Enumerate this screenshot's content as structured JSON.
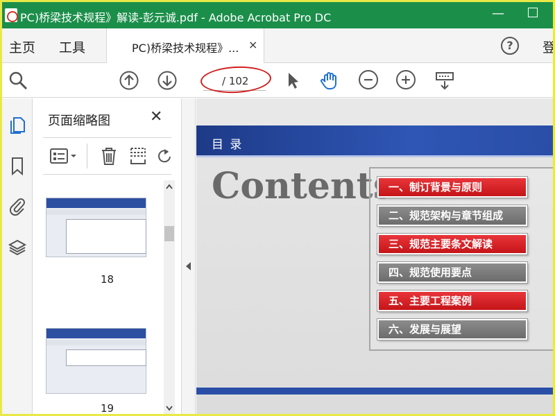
{
  "window": {
    "title": "PC)桥梁技术规程》解读-彭元诚.pdf - Adobe Acrobat Pro DC",
    "minimize_symbol": "—"
  },
  "tabs": {
    "home": "主页",
    "tools": "工具",
    "document": "PC)桥梁技术规程》...",
    "close_symbol": "×",
    "help_symbol": "?",
    "signin": "登"
  },
  "toolbar": {
    "page_total": "/ 102",
    "icons": [
      "search-icon",
      "page-up-icon",
      "page-down-icon",
      "select-arrow-icon",
      "hand-tool-icon",
      "zoom-out-icon",
      "zoom-in-icon",
      "keyboard-icon"
    ],
    "highlight_color": "#d11e1e"
  },
  "rail": {
    "icons": [
      "pages-icon",
      "bookmark-icon",
      "attachment-icon",
      "layers-icon"
    ]
  },
  "panel": {
    "title": "页面缩略图",
    "close_symbol": "✕",
    "thumbnails": [
      {
        "label": "18"
      },
      {
        "label": "19"
      }
    ]
  },
  "slide": {
    "heading": "目 录",
    "contents_word": "Contents",
    "toc": [
      {
        "label": "一、制订背景与原则",
        "style": "red"
      },
      {
        "label": "二、规范架构与章节组成",
        "style": "gray"
      },
      {
        "label": "三、规范主要条文解读",
        "style": "red"
      },
      {
        "label": "四、规范使用要点",
        "style": "gray"
      },
      {
        "label": "五、主要工程案例",
        "style": "red"
      },
      {
        "label": "六、发展与展望",
        "style": "gray"
      }
    ],
    "band_color": "#2f56b5",
    "red_color": "#d42226"
  },
  "colors": {
    "title_bar": "#1b8f4a",
    "frame": "#e8e846"
  }
}
